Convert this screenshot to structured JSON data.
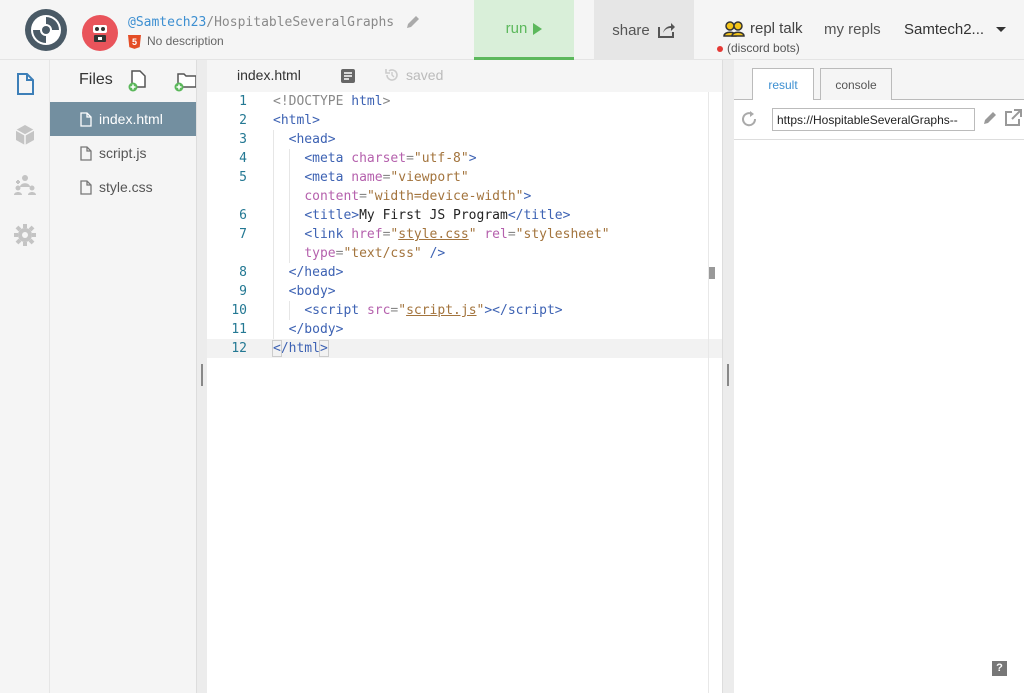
{
  "header": {
    "repl_user": "@Samtech23",
    "repl_sep": "/",
    "repl_name": "HospitableSeveralGraphs",
    "description": "No description",
    "run_label": "run",
    "share_label": "share",
    "repl_talk_label": "repl talk",
    "discord_label": "(discord bots)",
    "my_repls_label": "my repls",
    "username": "Samtech2..."
  },
  "files": {
    "title": "Files",
    "items": [
      {
        "name": "index.html"
      },
      {
        "name": "script.js"
      },
      {
        "name": "style.css"
      }
    ]
  },
  "editor": {
    "tab_file": "index.html",
    "saved_label": "saved",
    "line_numbers": [
      "1",
      "2",
      "3",
      "4",
      "5",
      "",
      "6",
      "7",
      "",
      "8",
      "9",
      "10",
      "11",
      "12"
    ]
  },
  "result": {
    "tab_result": "result",
    "tab_console": "console",
    "url": "https://HospitableSeveralGraphs--"
  },
  "help_label": "?",
  "colors": {
    "run_bg": "#d9efd9",
    "run_accent": "#5cb85c",
    "active_file_bg": "#738fa0",
    "tag": "#3d62b3",
    "attr": "#b561ad",
    "value": "#a3743d"
  }
}
